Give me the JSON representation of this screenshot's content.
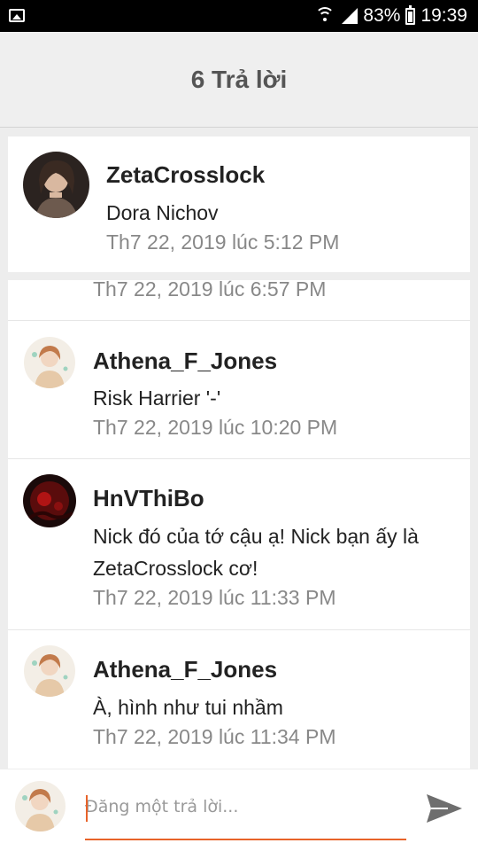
{
  "status_bar": {
    "battery": "83%",
    "time": "19:39"
  },
  "header": {
    "title": "6 Trả lời"
  },
  "post": {
    "author": "ZetaCrosslock",
    "content": "Dora Nichov",
    "timestamp": "Th7 22, 2019 lúc 5:12 PM"
  },
  "replies": [
    {
      "timestamp": "Th7 22, 2019 lúc 6:57 PM"
    },
    {
      "author": "Athena_F_Jones",
      "content": "Risk Harrier '-'",
      "timestamp": "Th7 22, 2019 lúc 10:20 PM"
    },
    {
      "author": "HnVThiBo",
      "content": "Nick đó của tớ cậu ạ! Nick bạn ấy là ZetaCrosslock cơ!",
      "timestamp": "Th7 22, 2019 lúc 11:33 PM"
    },
    {
      "author": "Athena_F_Jones",
      "content": "À, hình như tui nhầm",
      "timestamp": "Th7 22, 2019 lúc 11:34 PM"
    }
  ],
  "composer": {
    "placeholder": "Đăng một trả lời...",
    "value": ""
  },
  "colors": {
    "accent": "#e8632a",
    "header_bg": "#efefef",
    "page_bg": "#ededed"
  },
  "icons": [
    "image-icon",
    "wifi-icon",
    "signal-icon",
    "battery-icon",
    "send-icon"
  ]
}
